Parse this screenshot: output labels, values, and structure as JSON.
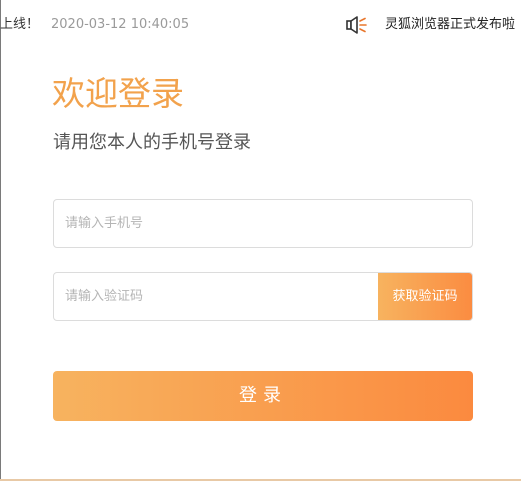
{
  "ticker": {
    "left_text": "上线！",
    "timestamp": "2020-03-12 10:40:05",
    "speaker_icon": "speaker-icon",
    "right_text": "灵狐浏览器正式发布啦"
  },
  "login": {
    "title": "欢迎登录",
    "subtitle": "请用您本人的手机号登录",
    "phone_placeholder": "请输入手机号",
    "code_placeholder": "请输入验证码",
    "get_code_label": "获取验证码",
    "submit_label": "登录"
  },
  "colors": {
    "accent": "#f2a24c",
    "gradient_start": "#f7b35f",
    "gradient_end": "#fb8a3f"
  }
}
